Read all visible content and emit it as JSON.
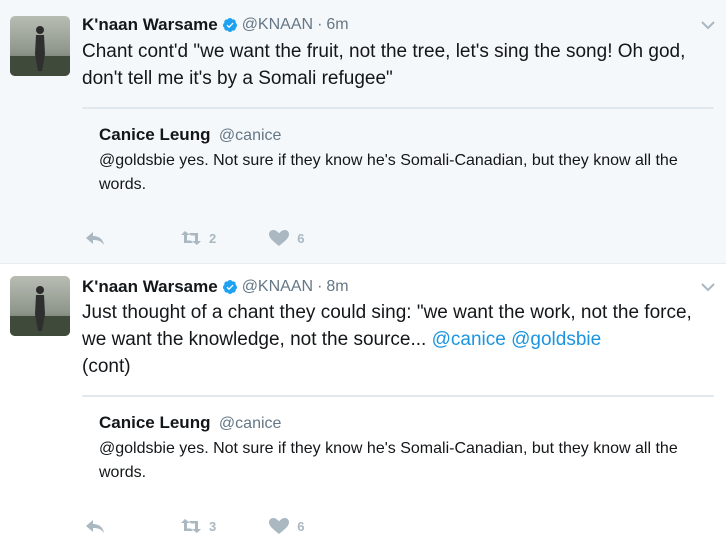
{
  "tweets": [
    {
      "author_name": "K'naan Warsame",
      "handle": "@KNAAN",
      "separator": "·",
      "time": "6m",
      "text": "Chant cont'd \"we want the fruit, not the tree, let's sing the song! Oh god, don't tell me it's by a Somali refugee\"",
      "quote": {
        "author_name": "Canice Leung",
        "handle": "@canice",
        "text": "@goldsbie yes. Not sure if they know he's Somali-Canadian, but they know all the words."
      },
      "retweets": "2",
      "likes": "6"
    },
    {
      "author_name": "K'naan Warsame",
      "handle": "@KNAAN",
      "separator": "·",
      "time": "8m",
      "text_main": "Just thought of a chant they could sing: \"we want the work, not the force, we want the knowledge, not the source... ",
      "mention_1": "@canice",
      "mention_2": "@goldsbie",
      "text_end": "(cont)",
      "quote": {
        "author_name": "Canice Leung",
        "handle": "@canice",
        "text": "@goldsbie yes. Not sure if they know he's Somali-Canadian, but they know all the words."
      },
      "retweets": "3",
      "likes": "6"
    }
  ],
  "colors": {
    "link": "#1b95e0",
    "muted": "#657786",
    "action_icon": "#aab8c2",
    "verified": "#1da1f2",
    "highlight_bg": "#f5f8fa"
  },
  "icons": [
    "verified-badge-icon",
    "chevron-down-icon",
    "reply-icon",
    "retweet-icon",
    "heart-icon"
  ]
}
